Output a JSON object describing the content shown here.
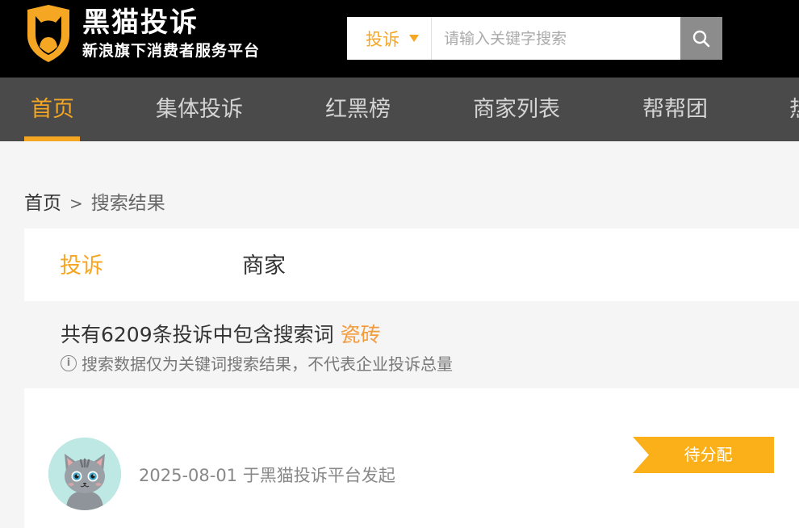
{
  "brand": {
    "title": "黑猫投诉",
    "subtitle": "新浪旗下消费者服务平台",
    "colors": {
      "accent": "#f5a623",
      "header_bg": "#000000",
      "nav_bg": "#4a4a4a"
    }
  },
  "search": {
    "type_label": "投诉",
    "placeholder": "请输入关键字搜索",
    "value": "",
    "icon": "search-icon"
  },
  "nav": {
    "items": [
      {
        "label": "首页",
        "active": true
      },
      {
        "label": "集体投诉"
      },
      {
        "label": "红黑榜"
      },
      {
        "label": "商家列表"
      },
      {
        "label": "帮帮团"
      },
      {
        "label": "热"
      }
    ]
  },
  "breadcrumb": {
    "home": "首页",
    "separator": ">",
    "current": "搜索结果"
  },
  "tabs": {
    "complaint": "投诉",
    "merchant": "商家",
    "active": "complaint"
  },
  "summary": {
    "prefix": "共有6209条投诉中包含搜索词",
    "keyword": "瓷砖",
    "notice": "搜索数据仅为关键词搜索结果，不代表企业投诉总量",
    "notice_icon": "info-icon"
  },
  "result": {
    "meta": "2025-08-01 于黑猫投诉平台发起",
    "status": "待分配",
    "status_color": "#fbb019"
  }
}
